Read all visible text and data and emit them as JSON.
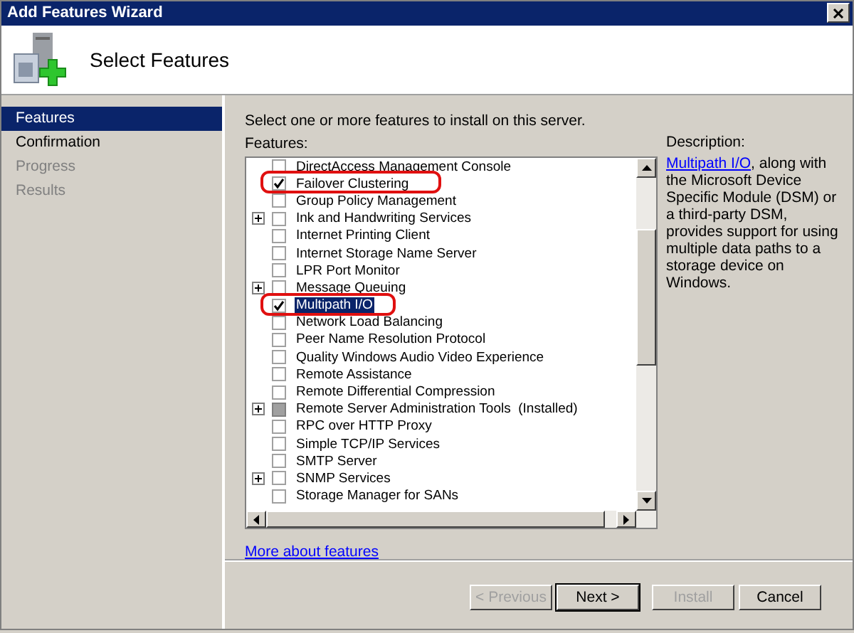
{
  "window": {
    "title": "Add Features Wizard"
  },
  "header": {
    "title": "Select Features"
  },
  "sidebar": {
    "items": [
      {
        "label": "Features",
        "selected": true,
        "disabled": false
      },
      {
        "label": "Confirmation",
        "selected": false,
        "disabled": false
      },
      {
        "label": "Progress",
        "selected": false,
        "disabled": true
      },
      {
        "label": "Results",
        "selected": false,
        "disabled": true
      }
    ]
  },
  "instruction": "Select one or more features to install on this server.",
  "features": {
    "label": "Features:",
    "items": [
      {
        "label": "DirectAccess Management Console",
        "checked": false,
        "disabled": false,
        "expandable": false,
        "selected": false,
        "highlighted": false
      },
      {
        "label": "Failover Clustering",
        "checked": true,
        "disabled": false,
        "expandable": false,
        "selected": false,
        "highlighted": true
      },
      {
        "label": "Group Policy Management",
        "checked": false,
        "disabled": false,
        "expandable": false,
        "selected": false,
        "highlighted": false
      },
      {
        "label": "Ink and Handwriting Services",
        "checked": false,
        "disabled": false,
        "expandable": true,
        "selected": false,
        "highlighted": false
      },
      {
        "label": "Internet Printing Client",
        "checked": false,
        "disabled": false,
        "expandable": false,
        "selected": false,
        "highlighted": false
      },
      {
        "label": "Internet Storage Name Server",
        "checked": false,
        "disabled": false,
        "expandable": false,
        "selected": false,
        "highlighted": false
      },
      {
        "label": "LPR Port Monitor",
        "checked": false,
        "disabled": false,
        "expandable": false,
        "selected": false,
        "highlighted": false
      },
      {
        "label": "Message Queuing",
        "checked": false,
        "disabled": false,
        "expandable": true,
        "selected": false,
        "highlighted": false
      },
      {
        "label": "Multipath I/O",
        "checked": true,
        "disabled": false,
        "expandable": false,
        "selected": true,
        "highlighted": true
      },
      {
        "label": "Network Load Balancing",
        "checked": false,
        "disabled": false,
        "expandable": false,
        "selected": false,
        "highlighted": false
      },
      {
        "label": "Peer Name Resolution Protocol",
        "checked": false,
        "disabled": false,
        "expandable": false,
        "selected": false,
        "highlighted": false
      },
      {
        "label": "Quality Windows Audio Video Experience",
        "checked": false,
        "disabled": false,
        "expandable": false,
        "selected": false,
        "highlighted": false
      },
      {
        "label": "Remote Assistance",
        "checked": false,
        "disabled": false,
        "expandable": false,
        "selected": false,
        "highlighted": false
      },
      {
        "label": "Remote Differential Compression",
        "checked": false,
        "disabled": false,
        "expandable": false,
        "selected": false,
        "highlighted": false
      },
      {
        "label": "Remote Server Administration Tools  (Installed)",
        "checked": false,
        "disabled": true,
        "expandable": true,
        "selected": false,
        "highlighted": false
      },
      {
        "label": "RPC over HTTP Proxy",
        "checked": false,
        "disabled": false,
        "expandable": false,
        "selected": false,
        "highlighted": false
      },
      {
        "label": "Simple TCP/IP Services",
        "checked": false,
        "disabled": false,
        "expandable": false,
        "selected": false,
        "highlighted": false
      },
      {
        "label": "SMTP Server",
        "checked": false,
        "disabled": false,
        "expandable": false,
        "selected": false,
        "highlighted": false
      },
      {
        "label": "SNMP Services",
        "checked": false,
        "disabled": false,
        "expandable": true,
        "selected": false,
        "highlighted": false
      },
      {
        "label": "Storage Manager for SANs",
        "checked": false,
        "disabled": false,
        "expandable": false,
        "selected": false,
        "highlighted": false
      }
    ]
  },
  "description": {
    "label": "Description:",
    "link": "Multipath I/O",
    "text": ", along with the Microsoft Device Specific Module (DSM) or a third-party DSM, provides support for using multiple data paths to a storage device on Windows."
  },
  "more_link": "More about features",
  "buttons": [
    {
      "label": "< Previous",
      "disabled": true,
      "default": false
    },
    {
      "label": "Next >",
      "disabled": false,
      "default": true
    },
    {
      "label": "Install",
      "disabled": true,
      "default": false
    },
    {
      "label": "Cancel",
      "disabled": false,
      "default": false
    }
  ]
}
